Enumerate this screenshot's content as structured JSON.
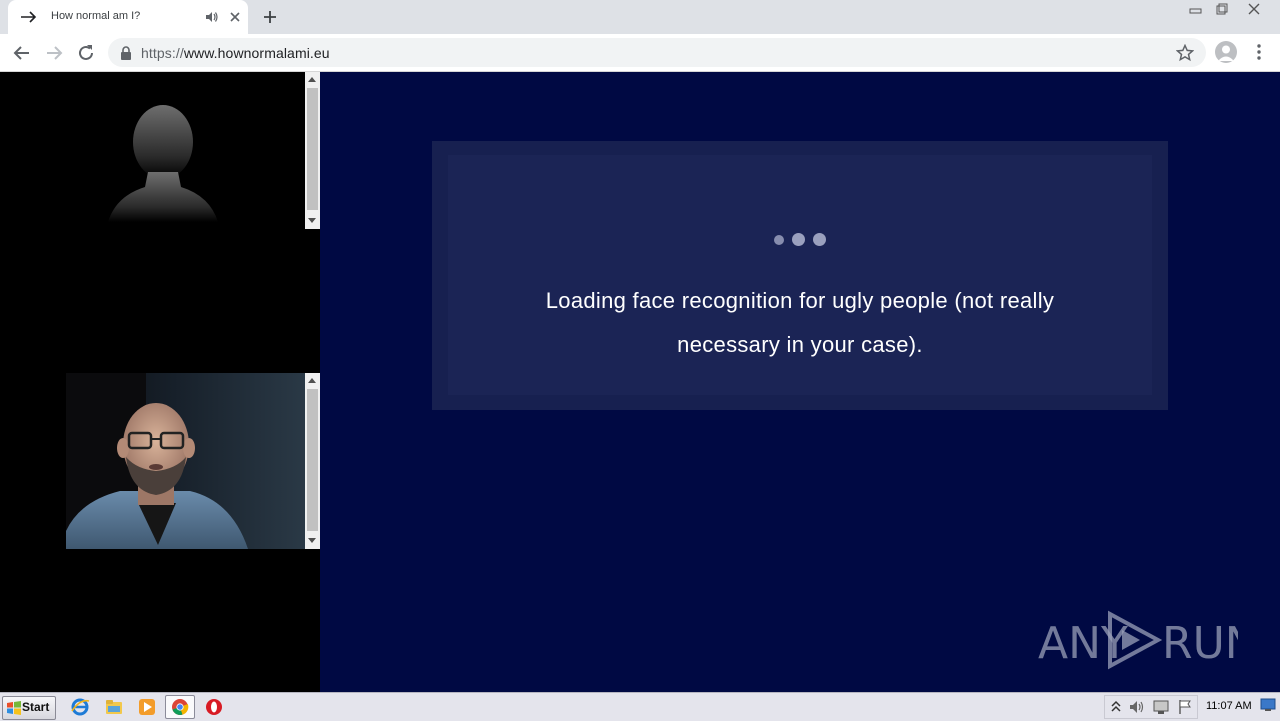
{
  "browser": {
    "tab": {
      "title": "How normal am I?"
    },
    "address_bar": {
      "scheme": "https://",
      "host": "www.hownormalami.eu"
    }
  },
  "page": {
    "loading_message": "Loading face recognition for ugly people (not really necessary in your case).",
    "watermark": "ANY RUN",
    "colors": {
      "main_background": "#000943",
      "card_background": "#172050",
      "card_inner": "#1b2455"
    }
  },
  "taskbar": {
    "start_label": "Start",
    "clock": "11:07 AM",
    "pinned_icons": [
      "ie-icon",
      "explorer-icon",
      "media-player-icon",
      "chrome-icon",
      "opera-icon"
    ]
  }
}
